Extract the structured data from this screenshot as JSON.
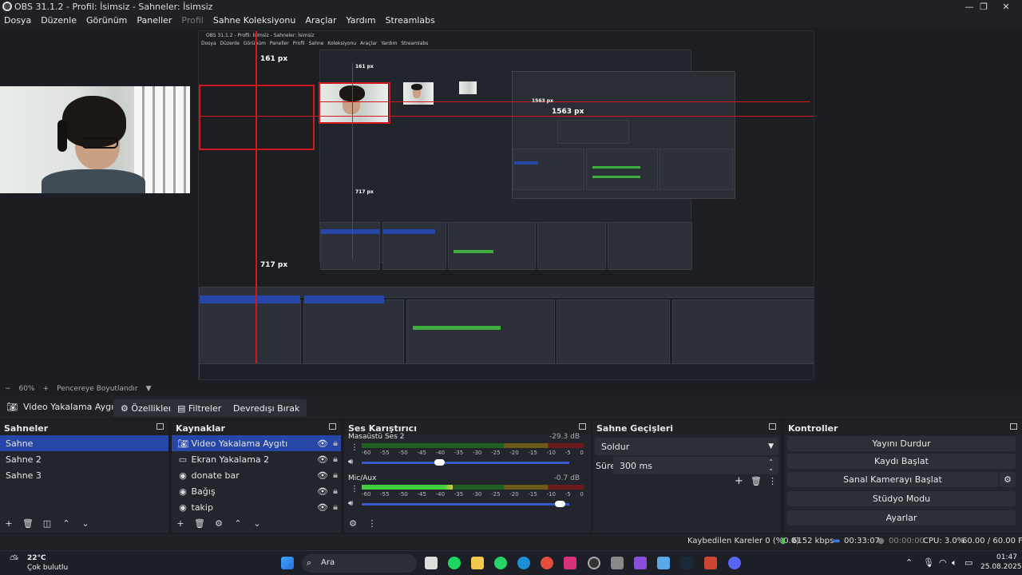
{
  "window": {
    "title": "OBS 31.1.2 - Profil: İsimsiz - Sahneler: İsimsiz",
    "minimize": "—",
    "maximize": "❐",
    "close": "✕"
  },
  "menu": [
    "Dosya",
    "Düzenle",
    "Görünüm",
    "Paneller",
    "Profil",
    "Sahne Koleksiyonu",
    "Araçlar",
    "Yardım",
    "Streamlabs"
  ],
  "preview": {
    "nested_title": "OBS 31.1.2 - Profil: İsimsiz - Sahneler: İsimsiz",
    "label_top": "161 px",
    "label_right": "1563 px",
    "label_bottom": "717 px",
    "nested_label_top": "161 px",
    "nested_label_right": "1563 px",
    "nested_label_bottom": "717 px"
  },
  "zoom_strip": {
    "minus": "−",
    "zoom": "60%",
    "plus": "+",
    "mode": "Pencereye Boyutlandır",
    "caret": "▼"
  },
  "source_bar": {
    "selected_source": "Video Yakalama Aygıtı",
    "properties": "Özellikler",
    "filters": "Filtreler",
    "deactivate": "Devredışı Bırak"
  },
  "scenes": {
    "title": "Sahneler",
    "items": [
      "Sahne",
      "Sahne 2",
      "Sahne 3"
    ]
  },
  "sources": {
    "title": "Kaynaklar",
    "items": [
      "Video Yakalama Aygıtı",
      "Ekran Yakalama 2",
      "donate bar",
      "Bağış",
      "takip"
    ]
  },
  "mixer": {
    "title": "Ses Karıştırıcı",
    "channels": [
      {
        "name": "Masaüstü Ses 2",
        "db": "-29.3 dB",
        "level": 0.0,
        "volume": 0.4
      },
      {
        "name": "Mic/Aux",
        "db": "-0.7 dB",
        "level": 0.41,
        "volume": 0.98
      }
    ],
    "ticks": [
      "-60",
      "-55",
      "-50",
      "-45",
      "-40",
      "-35",
      "-30",
      "-25",
      "-20",
      "-15",
      "-10",
      "-5",
      "0"
    ]
  },
  "transitions": {
    "title": "Sahne Geçişleri",
    "type": "Soldur",
    "duration_label": "Süre",
    "duration": "300 ms"
  },
  "controls": {
    "title": "Kontroller",
    "buttons": [
      "Yayını Durdur",
      "Kaydı Başlat",
      "Sanal Kamerayı Başlat",
      "Stüdyo Modu",
      "Ayarlar"
    ]
  },
  "status": {
    "dropped": "Kaybedilen Kareler 0 (%0.0)",
    "bitrate": "6152 kbps",
    "stream_time": "00:33:07",
    "rec_time": "00:00:00",
    "cpu": "CPU: 3.0%",
    "fps": "60.00 / 60.00 FPS"
  },
  "taskbar": {
    "weather_temp": "22°C",
    "weather_text": "Çok bulutlu",
    "search": "Ara",
    "time": "01:47",
    "date": "25.08.2025"
  }
}
